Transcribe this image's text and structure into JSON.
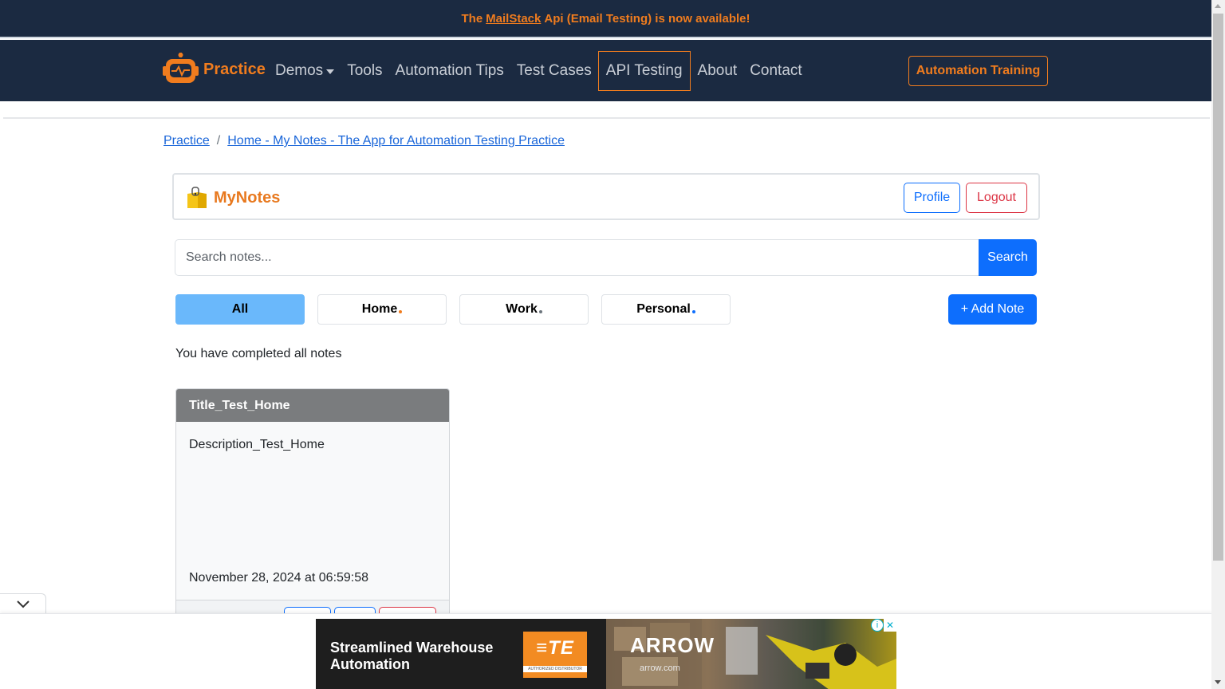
{
  "announcement": {
    "prefix": "The",
    "link": "MailStack",
    "suffix": "Api (Email Testing) is now available!"
  },
  "nav": {
    "brand": "Practice",
    "links": [
      {
        "label": "Demos"
      },
      {
        "label": "Tools"
      },
      {
        "label": "Automation Tips"
      },
      {
        "label": "Test Cases"
      },
      {
        "label": "API Testing"
      },
      {
        "label": "About"
      },
      {
        "label": "Contact"
      }
    ],
    "training_button": "Automation Training"
  },
  "breadcrumb": {
    "items": [
      "Practice",
      "Home - My Notes - The App for Automation Testing Practice"
    ],
    "separator": "/"
  },
  "app": {
    "logo_text": "MyNotes",
    "profile_label": "Profile",
    "logout_label": "Logout"
  },
  "search": {
    "placeholder": "Search notes...",
    "value": "",
    "button_label": "Search"
  },
  "categories": [
    {
      "label": "All",
      "dot_color": ""
    },
    {
      "label": "Home",
      "dot_color": "#f07c1e"
    },
    {
      "label": "Work",
      "dot_color": "#6c757d"
    },
    {
      "label": "Personal",
      "dot_color": "#0d6efd"
    }
  ],
  "add_note_label": "+ Add Note",
  "status_message": "You have completed all notes",
  "notes": [
    {
      "title": "Title_Test_Home",
      "description": "Description_Test_Home",
      "date": "November 28, 2024 at 06:59:58"
    }
  ],
  "ad": {
    "headline": "Streamlined Warehouse Automation",
    "te_logo": "≡TE",
    "te_sub": "AUTHORIZED DISTRIBUTOR",
    "arrow_logo": "ARROW",
    "arrow_sub": "arrow.com",
    "info_icon": "info-icon",
    "close_icon": "close-icon"
  },
  "colors": {
    "navy": "#1b2a41",
    "orange": "#f07c1e",
    "primary": "#0d6efd",
    "danger": "#dc3545",
    "active_tab": "#6ab8fb",
    "note_header": "#7a7c7e"
  }
}
